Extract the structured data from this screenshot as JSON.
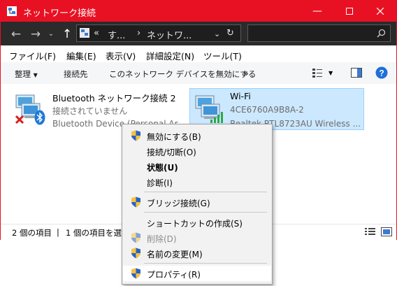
{
  "window": {
    "title": "ネットワーク接続"
  },
  "address": {
    "crumb1": "す...",
    "crumb2": "ネットワ...",
    "overflow": "«",
    "sep": "›"
  },
  "menu": [
    "ファイル(F)",
    "編集(E)",
    "表示(V)",
    "詳細設定(N)",
    "ツール(T)"
  ],
  "commands": {
    "organize": "整理",
    "connect": "接続先",
    "disable": "このネットワーク デバイスを無効にする",
    "more": "»",
    "help": "?"
  },
  "items": [
    {
      "name": "Bluetooth ネットワーク接続 2",
      "status": "接続されていません",
      "device": "Bluetooth Device (Personal Ar..."
    },
    {
      "name": "Wi-Fi",
      "status": "4CE6760A9B8A-2",
      "device": "Realtek RTL8723AU Wireless ..."
    }
  ],
  "status": {
    "count": "2 個の項目",
    "selected": "1 個の項目を選",
    "sep": "|"
  },
  "context_menu": [
    {
      "label": "無効にする(B)",
      "shield": true
    },
    {
      "label": "接続/切断(O)",
      "shield": false
    },
    {
      "label": "状態(U)",
      "shield": false,
      "bold": true
    },
    {
      "label": "診断(I)",
      "shield": false
    },
    {
      "label": "ブリッジ接続(G)",
      "shield": true
    },
    {
      "label": "ショートカットの作成(S)",
      "shield": false
    },
    {
      "label": "削除(D)",
      "shield": true,
      "disabled": true
    },
    {
      "label": "名前の変更(M)",
      "shield": true
    },
    {
      "label": "プロパティ(R)",
      "shield": true,
      "highlighted": true
    }
  ],
  "colors": {
    "accent": "#e81123",
    "selection": "#cce8ff",
    "selection_border": "#99d1ff"
  }
}
